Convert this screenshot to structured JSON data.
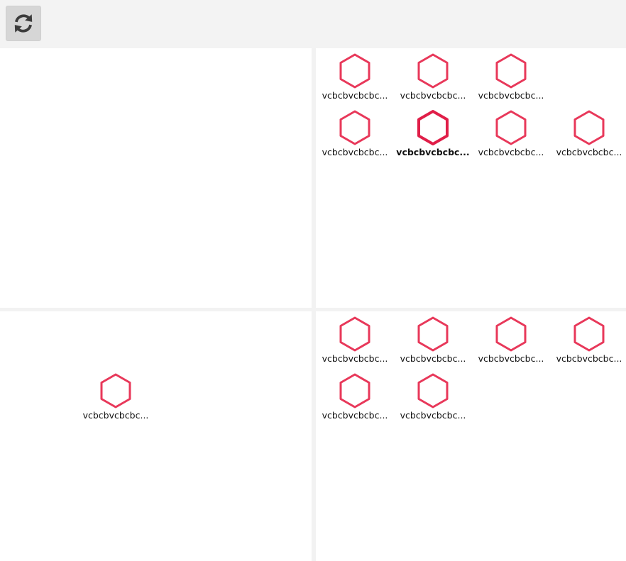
{
  "toolbar": {
    "refresh_icon": "refresh-icon"
  },
  "colors": {
    "hex_stroke": "#e8385a",
    "hex_stroke_selected": "#e01e48"
  },
  "panes": {
    "top_left": {
      "items": []
    },
    "top_right": {
      "items": [
        {
          "label": "vcbcbvcbcbc...",
          "selected": false
        },
        {
          "label": "vcbcbvcbcbc...",
          "selected": false
        },
        {
          "label": "vcbcbvcbcbc...",
          "selected": false
        },
        {
          "label": "vcbcbvcbcbc...",
          "selected": false
        },
        {
          "label": "vcbcbvcbcbc...",
          "selected": true
        },
        {
          "label": "vcbcbvcbcbc...",
          "selected": false
        },
        {
          "label": "vcbcbvcbcbc...",
          "selected": false
        }
      ]
    },
    "bottom_left": {
      "items": [
        {
          "label": "vcbcbvcbcbc...",
          "selected": false
        }
      ]
    },
    "bottom_right": {
      "items": [
        {
          "label": "vcbcbvcbcbc...",
          "selected": false
        },
        {
          "label": "vcbcbvcbcbc...",
          "selected": false
        },
        {
          "label": "vcbcbvcbcbc...",
          "selected": false
        },
        {
          "label": "vcbcbvcbcbc...",
          "selected": false
        },
        {
          "label": "vcbcbvcbcbc...",
          "selected": false
        },
        {
          "label": "vcbcbvcbcbc...",
          "selected": false
        }
      ]
    }
  }
}
